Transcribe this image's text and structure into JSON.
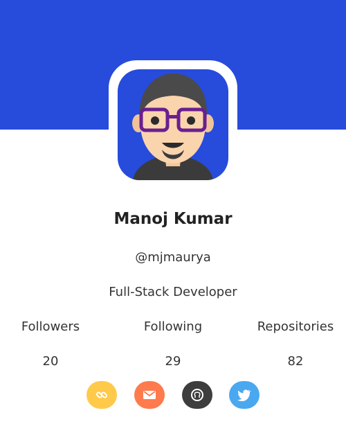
{
  "profile": {
    "name": "Manoj Kumar",
    "handle": "@mjmaurya",
    "role": "Full-Stack Developer"
  },
  "stats": [
    {
      "label": "Followers",
      "value": "20"
    },
    {
      "label": "Following",
      "value": "29"
    },
    {
      "label": "Repositories",
      "value": "82"
    }
  ],
  "social": [
    {
      "icon": "link-icon",
      "color": "#ffc94a"
    },
    {
      "icon": "mail-icon",
      "color": "#ff7a4d"
    },
    {
      "icon": "github-icon",
      "color": "#3d3d3d"
    },
    {
      "icon": "twitter-icon",
      "color": "#4aa8f0"
    }
  ],
  "theme": {
    "banner": "#274bdb",
    "card": "#ffffff"
  }
}
